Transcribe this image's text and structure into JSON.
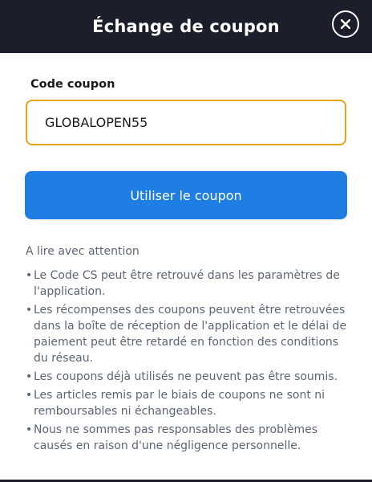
{
  "header": {
    "title": "Échange de coupon",
    "close_icon": "close-icon"
  },
  "form": {
    "label": "Code coupon",
    "coupon_value": "GLOBALOPEN55",
    "placeholder": "",
    "submit_label": "Utiliser le coupon"
  },
  "notes": {
    "title": "A lire avec attention",
    "items": [
      "Le Code CS peut être retrouvé dans les paramètres de l'application.",
      "Les récompenses des coupons peuvent être retrouvées dans la boîte de réception de l'application et le délai de paiement peut être retardé en fonction des conditions du réseau.",
      "Les coupons déjà utilisés ne peuvent pas être soumis.",
      "Les articles remis par le biais de coupons ne sont ni remboursables ni échangeables.",
      "Nous ne sommes pas responsables des problèmes causés en raison d'une négligence personnelle."
    ]
  },
  "colors": {
    "header_bg": "#1c1f2b",
    "input_border": "#e8a317",
    "button_bg": "#1f7ee3",
    "notes_text": "#5b6573"
  }
}
